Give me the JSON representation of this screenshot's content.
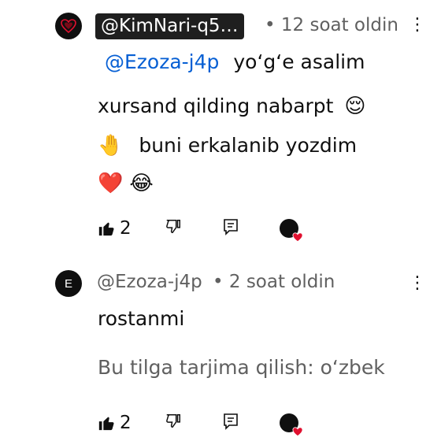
{
  "comment": {
    "author": "@KimNari-q5…",
    "meta": "• 12 soat oldin",
    "mention": "@Ezoza-j4p",
    "line1_rest": "yoʻgʻe asalim",
    "line2": "xursand qilding nabarpt",
    "line3": "buni erkalanib yozdim",
    "emoji_line2": "😌",
    "emoji_line3": "🤚",
    "emoji_line4a": "❤️",
    "emoji_line4b": "😂",
    "likes": "2"
  },
  "reply": {
    "avatar_letter": "E",
    "author": "@Ezoza-j4p",
    "meta": "• 2 soat oldin",
    "text": "rostanmi",
    "translate": "Bu tilga tarjima qilish: oʻzbek",
    "likes": "2"
  },
  "icons": {
    "like": "thumbs-up-icon",
    "dislike": "thumbs-down-icon",
    "reply": "reply-icon",
    "creator_heart": "creator-heart-icon",
    "menu": "more-vert-icon"
  },
  "colors": {
    "mention": "#065fd4",
    "heart": "#e0102f"
  }
}
